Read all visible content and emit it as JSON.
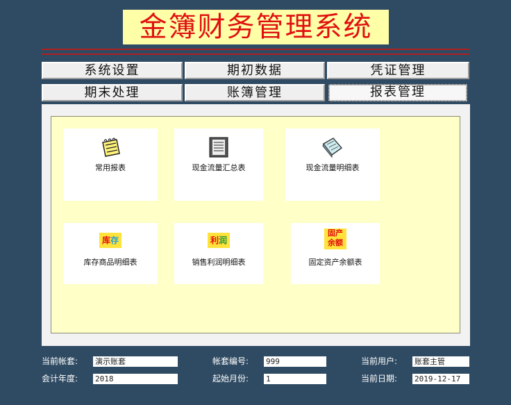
{
  "app": {
    "title": "金簿财务管理系统"
  },
  "tabs": [
    {
      "label": "系统设置"
    },
    {
      "label": "期初数据"
    },
    {
      "label": "凭证管理"
    },
    {
      "label": "期末处理"
    },
    {
      "label": "账簿管理"
    },
    {
      "label": "报表管理"
    }
  ],
  "reports": [
    {
      "label": "常用报表",
      "icon": "notepad-icon"
    },
    {
      "label": "现金流量汇总表",
      "icon": "document-icon"
    },
    {
      "label": "现金流量明细表",
      "icon": "book-icon"
    },
    {
      "label": "库存商品明细表",
      "icon": "inventory-icon",
      "badge": [
        "库",
        "存"
      ]
    },
    {
      "label": "销售利润明细表",
      "icon": "profit-icon",
      "badge": [
        "利",
        "润"
      ]
    },
    {
      "label": "固定资产余额表",
      "icon": "fixed-asset-icon",
      "badge": [
        "固产",
        "余额"
      ]
    }
  ],
  "status": {
    "account_set_label": "当前帐套:",
    "account_set_value": "演示账套",
    "account_no_label": "帐套编号:",
    "account_no_value": "999",
    "user_label": "当前用户:",
    "user_value": "账套主管",
    "year_label": "会计年度:",
    "year_value": "2018",
    "start_month_label": "起始月份:",
    "start_month_value": "1",
    "date_label": "当前日期:",
    "date_value": "2019-12-17"
  }
}
